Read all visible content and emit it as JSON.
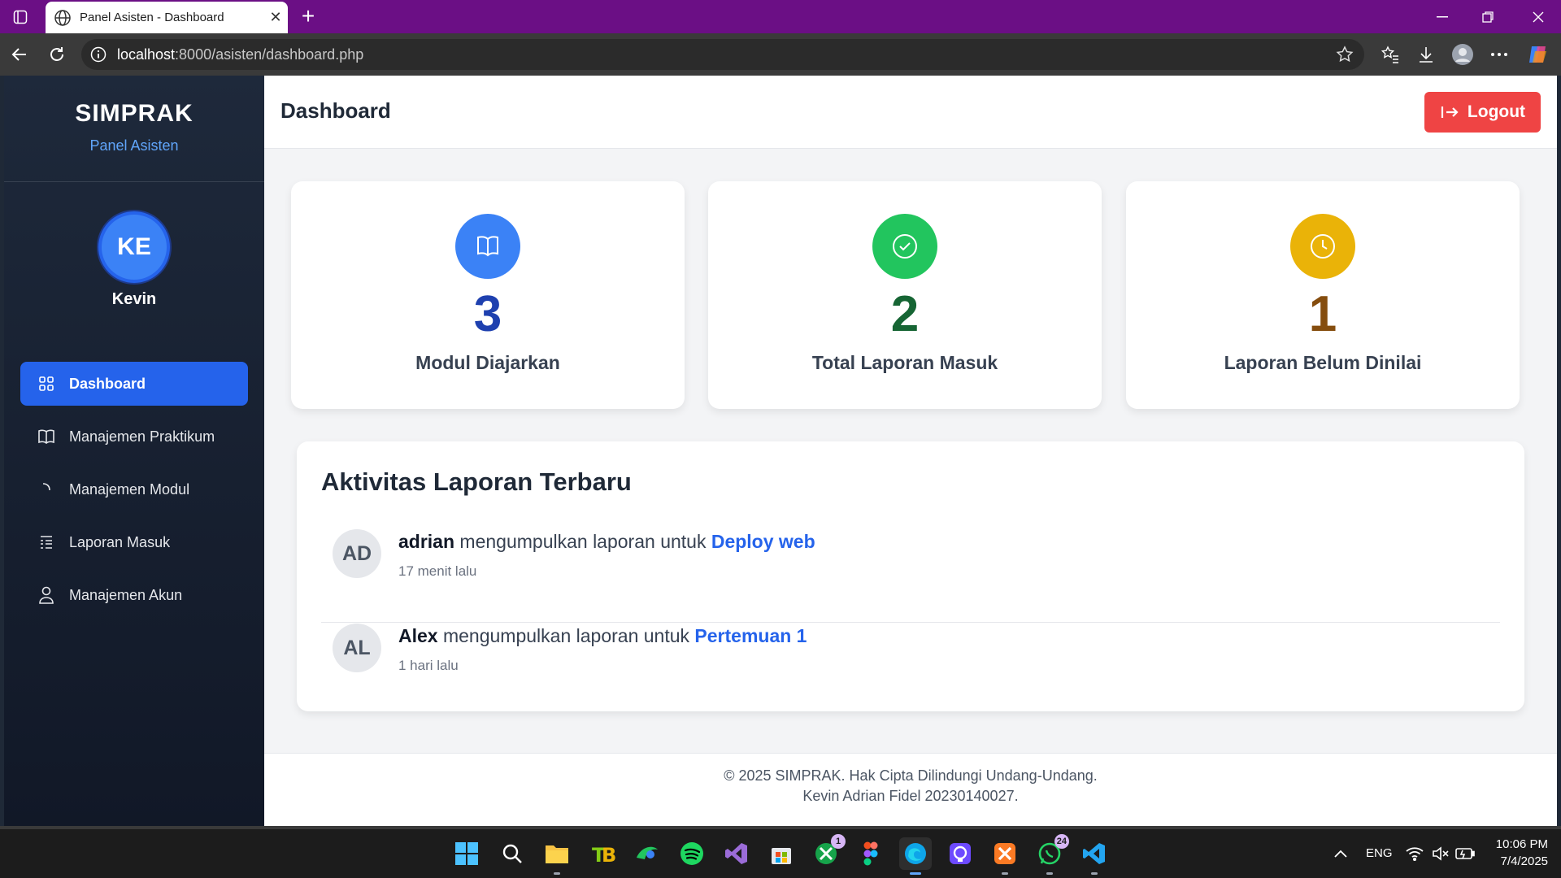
{
  "browser": {
    "tab_title": "Panel Asisten - Dashboard",
    "url_host": "localhost",
    "url_path": ":8000/asisten/dashboard.php"
  },
  "sidebar": {
    "brand": "SIMPRAK",
    "subtitle": "Panel Asisten",
    "avatar_initials": "KE",
    "user_name": "Kevin",
    "items": [
      {
        "label": "Dashboard",
        "icon": "grid-icon",
        "active": true
      },
      {
        "label": "Manajemen Praktikum",
        "icon": "book-icon",
        "active": false
      },
      {
        "label": "Manajemen Modul",
        "icon": "corner-icon",
        "active": false
      },
      {
        "label": "Laporan Masuk",
        "icon": "list-icon",
        "active": false
      },
      {
        "label": "Manajemen Akun",
        "icon": "user-icon",
        "active": false
      }
    ]
  },
  "header": {
    "title": "Dashboard",
    "logout_label": "Logout"
  },
  "stats": [
    {
      "value": "3",
      "label": "Modul Diajarkan",
      "icon": "book-open-icon",
      "icon_bg": "#3b82f6",
      "value_color": "#1e40af"
    },
    {
      "value": "2",
      "label": "Total Laporan Masuk",
      "icon": "check-circle-icon",
      "icon_bg": "#22c55e",
      "value_color": "#166534"
    },
    {
      "value": "1",
      "label": "Laporan Belum Dinilai",
      "icon": "clock-icon",
      "icon_bg": "#eab308",
      "value_color": "#854d0e"
    }
  ],
  "activity": {
    "title": "Aktivitas Laporan Terbaru",
    "items": [
      {
        "initials": "AD",
        "name": "adrian",
        "action": " mengumpulkan laporan untuk ",
        "module": "Deploy web",
        "time": "17 menit lalu"
      },
      {
        "initials": "AL",
        "name": "Alex",
        "action": " mengumpulkan laporan untuk ",
        "module": "Pertemuan 1",
        "time": "1 hari lalu"
      }
    ]
  },
  "footer": {
    "line1": "© 2025 SIMPRAK. Hak Cipta Dilindungi Undang-Undang.",
    "line2": "Kevin Adrian Fidel 20230140027."
  },
  "taskbar": {
    "lang": "ENG",
    "time": "10:06 PM",
    "date": "7/4/2025",
    "badges": {
      "xbox": "1",
      "whatsapp": "24"
    }
  },
  "colors": {
    "titlebar": "#6b0f85",
    "accent": "#2563eb",
    "logout": "#ef4444"
  }
}
